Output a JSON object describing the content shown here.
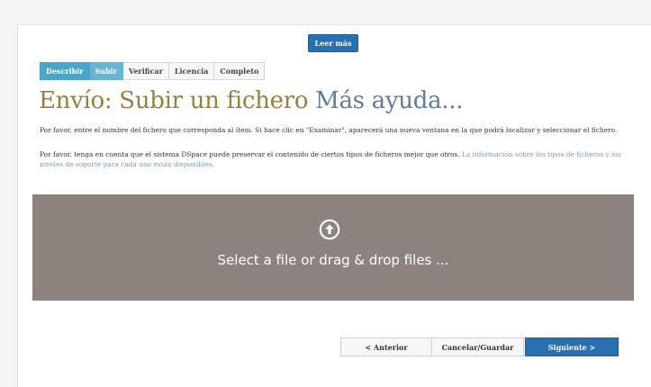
{
  "read_more_label": "Leer más",
  "steps": [
    {
      "label": "Describir",
      "state": "done"
    },
    {
      "label": "Subir",
      "state": "active"
    },
    {
      "label": "Verificar",
      "state": "pending"
    },
    {
      "label": "Licencia",
      "state": "pending"
    },
    {
      "label": "Completo",
      "state": "pending"
    }
  ],
  "heading": {
    "title": "Envío: Subir un fichero",
    "help_link": "Más ayuda..."
  },
  "instructions": {
    "p1": "Por favor, entre el nombre del fichero que corresponda al ítem. Si hace clic en \"Examinar\", aparecerá una nueva ventana en la que podrá localizar y seleccionar el fichero.",
    "p2_text": "Por favor, tenga en cuenta que el sistema DSpace puede preservar el contenido de ciertos tipos de ficheros mejor que otros.",
    "p2_link": "La información sobre los tipos de ficheros y los niveles de soporte para cada uno están disponibles."
  },
  "dropzone": {
    "icon": "upload-circle-icon",
    "text": "Select a file or drag & drop files ..."
  },
  "buttons": {
    "previous": "< Anterior",
    "save": "Cancelar/Guardar",
    "next": "Siguiente >"
  },
  "colors": {
    "primary": "#2a6fb0",
    "step_done": "#4aa6c8",
    "title": "#9b7d3f",
    "help_link": "#5f7d9b",
    "dropzone": "#8c837f"
  }
}
